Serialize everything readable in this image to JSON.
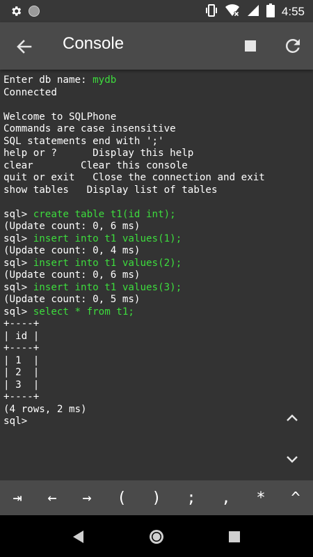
{
  "status_bar": {
    "time": "4:55",
    "left_icons": [
      "settings-icon",
      "record-dot-icon"
    ],
    "right_icons": [
      "vibrate-icon",
      "wifi-off-icon",
      "signal-icon",
      "battery-icon"
    ]
  },
  "app_bar": {
    "title": "Console",
    "icons": [
      "back-arrow-icon",
      "stop-icon",
      "refresh-icon"
    ]
  },
  "console": {
    "lines": [
      {
        "parts": [
          {
            "t": "Enter db name: ",
            "c": "w"
          },
          {
            "t": "mydb",
            "c": "g"
          }
        ]
      },
      {
        "parts": [
          {
            "t": "Connected",
            "c": "w"
          }
        ]
      },
      {
        "parts": [
          {
            "t": "",
            "c": "w"
          }
        ]
      },
      {
        "parts": [
          {
            "t": "Welcome to SQLPhone",
            "c": "w"
          }
        ]
      },
      {
        "parts": [
          {
            "t": "Commands are case insensitive",
            "c": "w"
          }
        ]
      },
      {
        "parts": [
          {
            "t": "SQL statements end with ';'",
            "c": "w"
          }
        ]
      },
      {
        "parts": [
          {
            "t": "help or ?      Display this help",
            "c": "w"
          }
        ]
      },
      {
        "parts": [
          {
            "t": "clear        Clear this console",
            "c": "w"
          }
        ]
      },
      {
        "parts": [
          {
            "t": "quit or exit   Close the connection and exit",
            "c": "w"
          }
        ]
      },
      {
        "parts": [
          {
            "t": "show tables   Display list of tables",
            "c": "w"
          }
        ]
      },
      {
        "parts": [
          {
            "t": "",
            "c": "w"
          }
        ]
      },
      {
        "parts": [
          {
            "t": "sql> ",
            "c": "w"
          },
          {
            "t": "create table t1(id int);",
            "c": "g"
          }
        ]
      },
      {
        "parts": [
          {
            "t": "(Update count: 0, 6 ms)",
            "c": "w"
          }
        ]
      },
      {
        "parts": [
          {
            "t": "sql> ",
            "c": "w"
          },
          {
            "t": "insert into t1 values(1);",
            "c": "g"
          }
        ]
      },
      {
        "parts": [
          {
            "t": "(Update count: 0, 4 ms)",
            "c": "w"
          }
        ]
      },
      {
        "parts": [
          {
            "t": "sql> ",
            "c": "w"
          },
          {
            "t": "insert into t1 values(2);",
            "c": "g"
          }
        ]
      },
      {
        "parts": [
          {
            "t": "(Update count: 0, 6 ms)",
            "c": "w"
          }
        ]
      },
      {
        "parts": [
          {
            "t": "sql> ",
            "c": "w"
          },
          {
            "t": "insert into t1 values(3);",
            "c": "g"
          }
        ]
      },
      {
        "parts": [
          {
            "t": "(Update count: 0, 5 ms)",
            "c": "w"
          }
        ]
      },
      {
        "parts": [
          {
            "t": "sql> ",
            "c": "w"
          },
          {
            "t": "select * from t1;",
            "c": "g"
          }
        ]
      },
      {
        "parts": [
          {
            "t": "+----+",
            "c": "w"
          }
        ]
      },
      {
        "parts": [
          {
            "t": "| id |",
            "c": "w"
          }
        ]
      },
      {
        "parts": [
          {
            "t": "+----+",
            "c": "w"
          }
        ]
      },
      {
        "parts": [
          {
            "t": "| 1  |",
            "c": "w"
          }
        ]
      },
      {
        "parts": [
          {
            "t": "| 2  |",
            "c": "w"
          }
        ]
      },
      {
        "parts": [
          {
            "t": "| 3  |",
            "c": "w"
          }
        ]
      },
      {
        "parts": [
          {
            "t": "+----+",
            "c": "w"
          }
        ]
      },
      {
        "parts": [
          {
            "t": "(4 rows, 2 ms)",
            "c": "w"
          }
        ]
      },
      {
        "parts": [
          {
            "t": "sql>",
            "c": "w"
          }
        ]
      }
    ]
  },
  "scroll_controls": {
    "up_icon": "chevron-up-icon",
    "down_icon": "chevron-down-icon"
  },
  "key_bar": {
    "keys": [
      {
        "label": "⇥",
        "name": "tab-key"
      },
      {
        "label": "←",
        "name": "left-arrow-key"
      },
      {
        "label": "→",
        "name": "right-arrow-key"
      },
      {
        "label": "(",
        "name": "open-paren-key"
      },
      {
        "label": ")",
        "name": "close-paren-key"
      },
      {
        "label": ";",
        "name": "semicolon-key"
      },
      {
        "label": ",",
        "name": "comma-key"
      },
      {
        "label": "*",
        "name": "asterisk-key"
      },
      {
        "label": "^",
        "name": "caret-up-key"
      }
    ]
  },
  "nav_bar": {
    "icons": [
      "back-triangle-icon",
      "home-circle-icon",
      "recents-square-icon"
    ]
  },
  "colors": {
    "command_green": "#3ddc3d",
    "background": "#333333",
    "app_bar": "#4a4a4a"
  }
}
